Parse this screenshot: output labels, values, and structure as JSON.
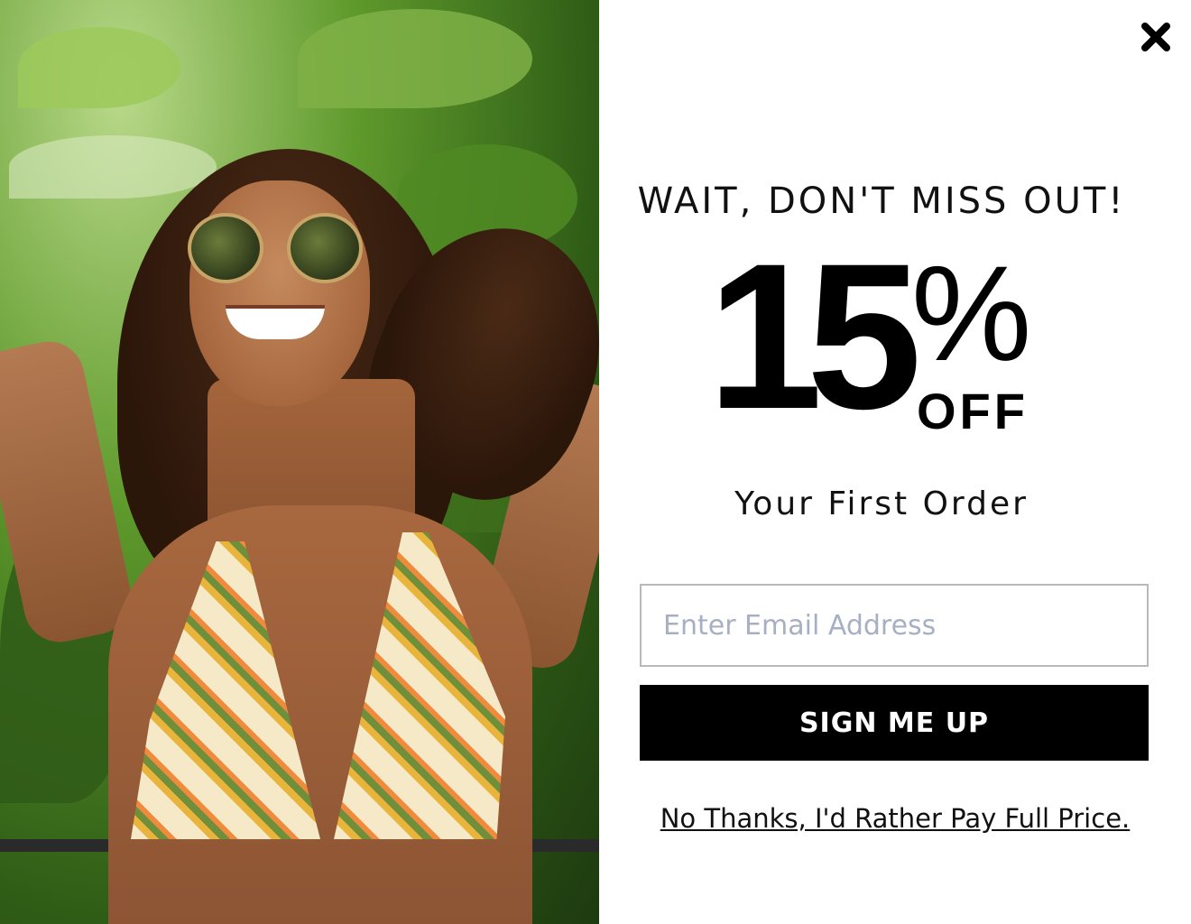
{
  "popup": {
    "headline": "WAIT, DON'T MISS OUT!",
    "discount_number": "15",
    "discount_percent": "%",
    "discount_off": "OFF",
    "subline": "Your First Order",
    "email_placeholder": "Enter Email Address",
    "email_value": "",
    "signup_label": "SIGN ME UP",
    "decline_label": "No Thanks, I'd Rather Pay Full Price.",
    "close_icon": "close-x-icon"
  },
  "colors": {
    "button_bg": "#000000",
    "button_text": "#ffffff",
    "placeholder": "#a7afc2",
    "input_border": "#b9b9b9"
  }
}
